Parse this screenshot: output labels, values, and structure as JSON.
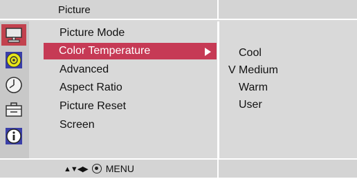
{
  "header": {
    "title": "Picture"
  },
  "sidebar": {
    "icons": [
      {
        "name": "monitor-icon",
        "active": true
      },
      {
        "name": "disc-icon",
        "active": false
      },
      {
        "name": "clock-icon",
        "active": false
      },
      {
        "name": "toolbox-icon",
        "active": false
      },
      {
        "name": "info-icon",
        "active": false
      }
    ]
  },
  "menu": {
    "items": [
      {
        "label": "Picture Mode"
      },
      {
        "label": "Color Temperature",
        "selected": true
      },
      {
        "label": "Advanced"
      },
      {
        "label": "Aspect Ratio"
      },
      {
        "label": "Picture Reset"
      },
      {
        "label": "Screen"
      }
    ]
  },
  "submenu": {
    "items": [
      {
        "label": "Cool",
        "checked": false
      },
      {
        "label": "Medium",
        "checked": true,
        "mark": "V"
      },
      {
        "label": "Warm",
        "checked": false
      },
      {
        "label": "User",
        "checked": false
      }
    ]
  },
  "footer": {
    "nav_arrows": "▲▼◀▶",
    "menu_label": "MENU"
  },
  "colors": {
    "accent": "#c63a55",
    "panel": "#d9d9d9",
    "divider": "#ffffff"
  }
}
